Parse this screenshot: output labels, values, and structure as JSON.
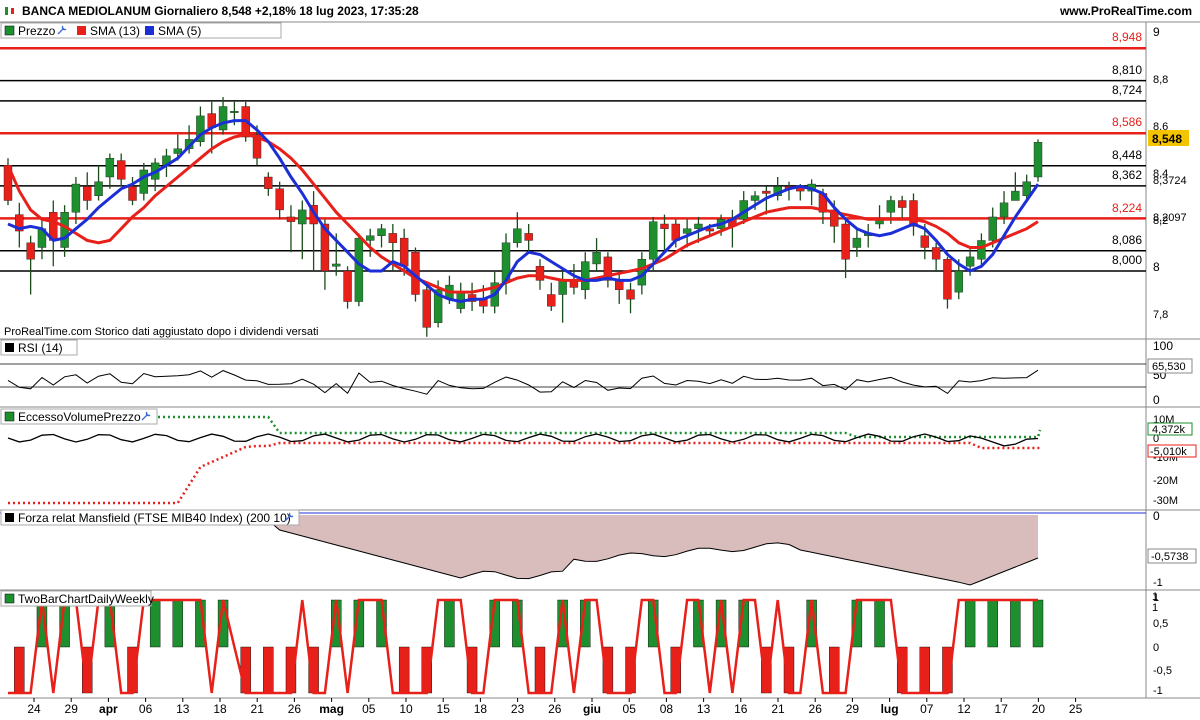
{
  "header": {
    "title": "BANCA MEDIOLANUM Giornaliero 8,548 +2,18% 18 lug 2023, 17:35:28",
    "url": "www.ProRealTime.com"
  },
  "price_panel": {
    "legend": [
      "Prezzo",
      "SMA (13)",
      "SMA (5)"
    ],
    "watermark": "ProRealTime.com  Storico dati aggiustato dopo i dividendi versati",
    "y_ticks": [
      "9",
      "8,8",
      "8,6",
      "8,4",
      "8,2",
      "8",
      "7,8"
    ],
    "level_labels": {
      "l8948": "8,948",
      "l8810": "8,810",
      "l8724": "8,724",
      "l8586": "8,586",
      "l8448": "8,448",
      "l8362": "8,362",
      "l8224": "8,224",
      "l8086": "8,086",
      "l8000": "8,000"
    },
    "current_price": "8,548",
    "sma5_value": "8,3724",
    "sma13_value": "8,2097"
  },
  "rsi_panel": {
    "label": "RSI (14)",
    "y_ticks": [
      "100",
      "50",
      "0"
    ],
    "value": "65,530"
  },
  "volume_panel": {
    "label": "EccessoVolumePrezzo",
    "y_ticks": [
      "10M",
      "0",
      "-10M",
      "-20M",
      "-30M"
    ],
    "values": [
      "4,372k",
      "-5,010k"
    ]
  },
  "mansfield_panel": {
    "label": "Forza relat Mansfield (FTSE MIB40 Index) (200 10)",
    "y_ticks": [
      "0",
      "-1"
    ],
    "value": "-0,5738"
  },
  "twobar_panel": {
    "label": "TwoBarChartDailyWeekly",
    "y_ticks": [
      "1",
      "0,5",
      "0",
      "-0,5",
      "-1"
    ],
    "values": [
      "1",
      "1"
    ]
  },
  "x_axis": {
    "labels": [
      "24",
      "29",
      "apr",
      "06",
      "13",
      "18",
      "21",
      "26",
      "mag",
      "05",
      "10",
      "15",
      "18",
      "23",
      "26",
      "giu",
      "05",
      "08",
      "13",
      "16",
      "21",
      "26",
      "29",
      "lug",
      "07",
      "12",
      "17",
      "20",
      "25"
    ]
  },
  "colors": {
    "up": "#1e8f2e",
    "down": "#e8201a",
    "sma13": "#e8201a",
    "sma5": "#1c2fd6",
    "red_level": "#e8201a",
    "black_level": "#000000",
    "mansfield_fill": "#d9bcbc"
  },
  "chart_data": {
    "type": "candlestick",
    "title": "BANCA MEDIOLANUM Giornaliero 8,548 +2,18% 18 lug 2023, 17:35:28",
    "ylim": [
      7.72,
      9.02
    ],
    "horizontal_levels": [
      {
        "value": 8.948,
        "color": "red"
      },
      {
        "value": 8.81,
        "color": "black"
      },
      {
        "value": 8.724,
        "color": "black"
      },
      {
        "value": 8.586,
        "color": "red"
      },
      {
        "value": 8.448,
        "color": "black"
      },
      {
        "value": 8.362,
        "color": "black"
      },
      {
        "value": 8.224,
        "color": "red"
      },
      {
        "value": 8.086,
        "color": "black"
      },
      {
        "value": 8.0,
        "color": "black"
      }
    ],
    "candles": [
      [
        8.45,
        8.3,
        8.48,
        8.28
      ],
      [
        8.24,
        8.17,
        8.29,
        8.1
      ],
      [
        8.12,
        8.05,
        8.15,
        7.9
      ],
      [
        8.1,
        8.18,
        8.22,
        8.05
      ],
      [
        8.25,
        8.13,
        8.3,
        8.02
      ],
      [
        8.1,
        8.25,
        8.28,
        8.06
      ],
      [
        8.25,
        8.37,
        8.4,
        8.2
      ],
      [
        8.36,
        8.3,
        8.42,
        8.26
      ],
      [
        8.32,
        8.38,
        8.45,
        8.3
      ],
      [
        8.4,
        8.48,
        8.5,
        8.35
      ],
      [
        8.47,
        8.39,
        8.5,
        8.36
      ],
      [
        8.36,
        8.3,
        8.4,
        8.28
      ],
      [
        8.33,
        8.43,
        8.46,
        8.3
      ],
      [
        8.39,
        8.46,
        8.48,
        8.34
      ],
      [
        8.45,
        8.49,
        8.52,
        8.4
      ],
      [
        8.5,
        8.52,
        8.58,
        8.47
      ],
      [
        8.52,
        8.56,
        8.62,
        8.5
      ],
      [
        8.55,
        8.66,
        8.7,
        8.53
      ],
      [
        8.67,
        8.61,
        8.72,
        8.5
      ],
      [
        8.6,
        8.7,
        8.74,
        8.58
      ],
      [
        8.68,
        8.68,
        8.72,
        8.62
      ],
      [
        8.7,
        8.57,
        8.72,
        8.55
      ],
      [
        8.58,
        8.48,
        8.62,
        8.45
      ],
      [
        8.4,
        8.35,
        8.42,
        8.32
      ],
      [
        8.35,
        8.26,
        8.38,
        8.22
      ],
      [
        8.23,
        8.21,
        8.28,
        8.08
      ],
      [
        8.2,
        8.26,
        8.3,
        8.05
      ],
      [
        8.28,
        8.2,
        8.34,
        8.0
      ],
      [
        8.2,
        8.0,
        8.22,
        7.92
      ],
      [
        8.02,
        8.03,
        8.16,
        7.98
      ],
      [
        8.0,
        7.87,
        8.02,
        7.84
      ],
      [
        7.87,
        8.14,
        8.16,
        7.85
      ],
      [
        8.13,
        8.15,
        8.18,
        8.06
      ],
      [
        8.15,
        8.18,
        8.2,
        8.1
      ],
      [
        8.16,
        8.12,
        8.2,
        8.0
      ],
      [
        8.14,
        8.02,
        8.18,
        7.98
      ],
      [
        8.08,
        7.9,
        8.1,
        7.87
      ],
      [
        7.92,
        7.76,
        7.95,
        7.72
      ],
      [
        7.78,
        7.92,
        7.96,
        7.76
      ],
      [
        7.88,
        7.94,
        7.98,
        7.86
      ],
      [
        7.84,
        7.91,
        7.95,
        7.82
      ],
      [
        7.9,
        7.87,
        7.95,
        7.83
      ],
      [
        7.88,
        7.85,
        7.94,
        7.82
      ],
      [
        7.85,
        7.95,
        8.0,
        7.82
      ],
      [
        7.95,
        8.12,
        8.16,
        7.9
      ],
      [
        8.12,
        8.18,
        8.25,
        8.1
      ],
      [
        8.16,
        8.13,
        8.2,
        8.08
      ],
      [
        8.02,
        7.96,
        8.05,
        7.92
      ],
      [
        7.9,
        7.85,
        7.95,
        7.83
      ],
      [
        7.9,
        7.96,
        8.0,
        7.78
      ],
      [
        7.96,
        7.93,
        8.03,
        7.9
      ],
      [
        7.92,
        8.04,
        8.08,
        7.88
      ],
      [
        8.03,
        8.08,
        8.14,
        8.0
      ],
      [
        8.06,
        7.96,
        8.08,
        7.93
      ],
      [
        7.96,
        7.92,
        8.0,
        7.86
      ],
      [
        7.92,
        7.88,
        7.95,
        7.82
      ],
      [
        7.94,
        8.05,
        8.08,
        7.9
      ],
      [
        8.05,
        8.21,
        8.23,
        8.0
      ],
      [
        8.2,
        8.18,
        8.24,
        8.08
      ],
      [
        8.2,
        8.13,
        8.22,
        8.1
      ],
      [
        8.16,
        8.18,
        8.22,
        8.1
      ],
      [
        8.18,
        8.2,
        8.23,
        8.12
      ],
      [
        8.18,
        8.17,
        8.2,
        8.15
      ],
      [
        8.18,
        8.22,
        8.24,
        8.15
      ],
      [
        8.22,
        8.19,
        8.26,
        8.1
      ],
      [
        8.22,
        8.3,
        8.34,
        8.2
      ],
      [
        8.3,
        8.32,
        8.34,
        8.26
      ],
      [
        8.34,
        8.33,
        8.36,
        8.24
      ],
      [
        8.32,
        8.36,
        8.4,
        8.3
      ],
      [
        8.36,
        8.35,
        8.38,
        8.3
      ],
      [
        8.36,
        8.34,
        8.37,
        8.3
      ],
      [
        8.34,
        8.37,
        8.39,
        8.28
      ],
      [
        8.33,
        8.25,
        8.35,
        8.2
      ],
      [
        8.26,
        8.19,
        8.3,
        8.12
      ],
      [
        8.2,
        8.05,
        8.22,
        7.97
      ],
      [
        8.1,
        8.14,
        8.18,
        8.06
      ],
      [
        8.15,
        8.16,
        8.2,
        8.1
      ],
      [
        8.2,
        8.22,
        8.28,
        8.18
      ],
      [
        8.25,
        8.3,
        8.32,
        8.2
      ],
      [
        8.3,
        8.27,
        8.32,
        8.22
      ],
      [
        8.3,
        8.19,
        8.33,
        8.15
      ],
      [
        8.15,
        8.1,
        8.2,
        8.05
      ],
      [
        8.1,
        8.05,
        8.12,
        8.0
      ],
      [
        8.05,
        7.88,
        8.06,
        7.84
      ],
      [
        7.91,
        8.0,
        8.05,
        7.88
      ],
      [
        8.02,
        8.06,
        8.1,
        7.98
      ],
      [
        8.05,
        8.13,
        8.16,
        8.02
      ],
      [
        8.13,
        8.23,
        8.27,
        8.1
      ],
      [
        8.23,
        8.29,
        8.34,
        8.2
      ],
      [
        8.3,
        8.34,
        8.42,
        8.3
      ],
      [
        8.32,
        8.38,
        8.41,
        8.3
      ],
      [
        8.4,
        8.548,
        8.56,
        8.38
      ]
    ],
    "series": [
      {
        "name": "SMA (13)",
        "values": [
          8.45,
          8.34,
          8.26,
          8.22,
          8.21,
          8.19,
          8.16,
          8.13,
          8.12,
          8.13,
          8.18,
          8.23,
          8.27,
          8.32,
          8.36,
          8.4,
          8.44,
          8.48,
          8.52,
          8.55,
          8.57,
          8.58,
          8.57,
          8.55,
          8.52,
          8.48,
          8.43,
          8.37,
          8.31,
          8.25,
          8.2,
          8.15,
          8.1,
          8.06,
          8.03,
          8.0,
          7.97,
          7.95,
          7.93,
          7.91,
          7.91,
          7.91,
          7.92,
          7.93,
          7.95,
          7.97,
          7.98,
          7.98,
          7.97,
          7.96,
          7.96,
          7.96,
          7.97,
          7.98,
          7.99,
          8.0,
          8.01,
          8.03,
          8.05,
          8.08,
          8.11,
          8.13,
          8.15,
          8.17,
          8.19,
          8.21,
          8.23,
          8.25,
          8.26,
          8.27,
          8.27,
          8.27,
          8.26,
          8.25,
          8.24,
          8.23,
          8.22,
          8.22,
          8.22,
          8.22,
          8.22,
          8.21,
          8.19,
          8.16,
          8.12,
          8.1,
          8.1,
          8.12,
          8.14,
          8.16,
          8.18,
          8.21
        ]
      },
      {
        "name": "SMA (5)",
        "values": [
          8.2,
          8.18,
          8.19,
          8.18,
          8.13,
          8.14,
          8.18,
          8.22,
          8.27,
          8.31,
          8.35,
          8.37,
          8.4,
          8.42,
          8.45,
          8.48,
          8.53,
          8.58,
          8.61,
          8.63,
          8.64,
          8.64,
          8.6,
          8.55,
          8.48,
          8.4,
          8.33,
          8.25,
          8.18,
          8.13,
          8.08,
          8.03,
          8.0,
          8.0,
          8.04,
          8.02,
          7.98,
          7.94,
          7.9,
          7.88,
          7.87,
          7.88,
          7.88,
          7.9,
          7.96,
          8.04,
          8.08,
          8.07,
          8.04,
          8.01,
          7.98,
          7.96,
          7.96,
          7.97,
          7.96,
          7.96,
          7.98,
          8.03,
          8.08,
          8.13,
          8.15,
          8.17,
          8.19,
          8.2,
          8.22,
          8.25,
          8.28,
          8.31,
          8.33,
          8.35,
          8.36,
          8.35,
          8.33,
          8.27,
          8.22,
          8.18,
          8.16,
          8.15,
          8.16,
          8.18,
          8.2,
          8.18,
          8.13,
          8.07,
          8.03,
          8.0,
          8.02,
          8.07,
          8.15,
          8.23,
          8.3,
          8.37
        ]
      }
    ]
  }
}
